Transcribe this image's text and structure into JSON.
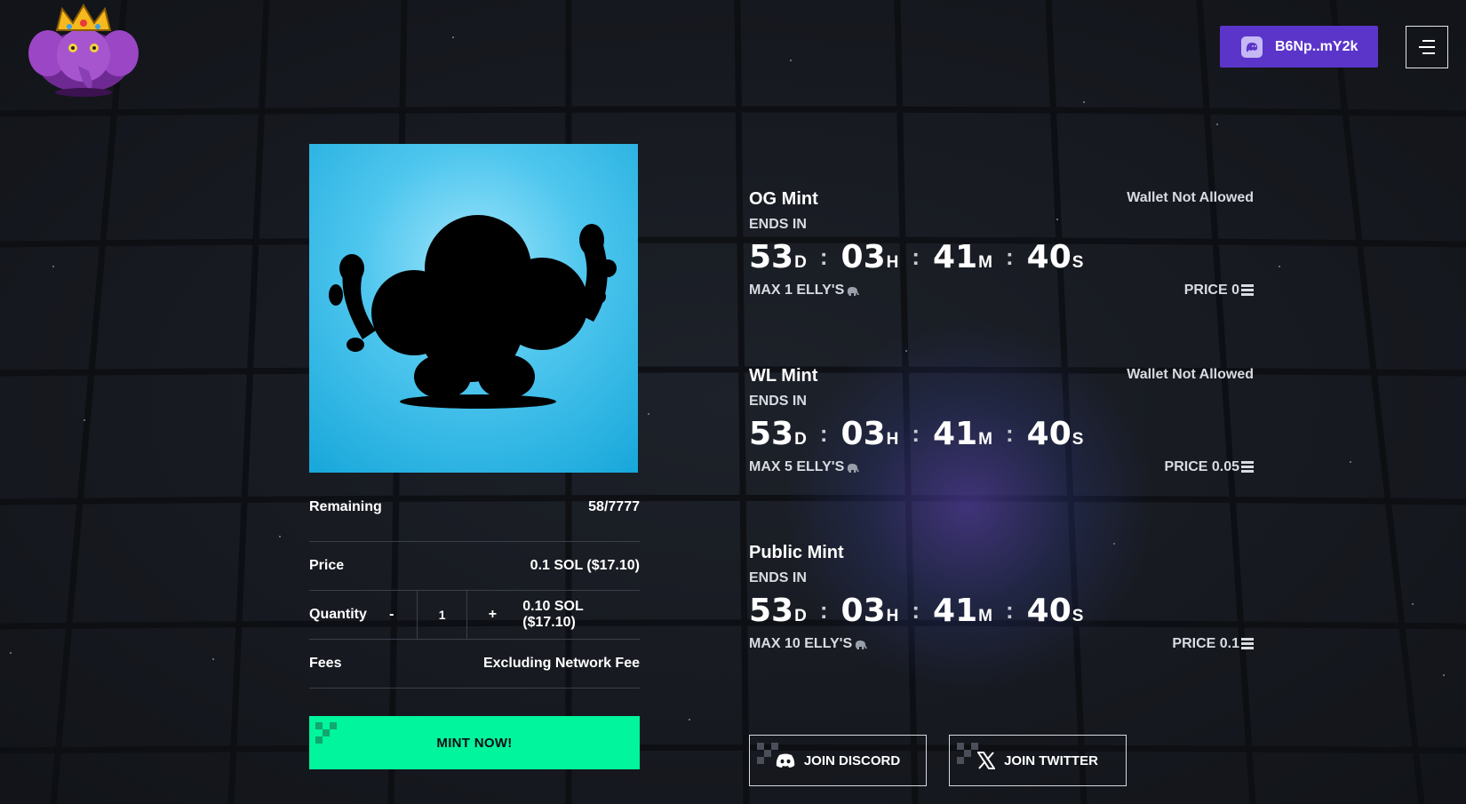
{
  "header": {
    "logo_alt": "Elly crown elephant logo",
    "wallet_label": "B6Np..mY2k",
    "wallet_icon": "ghost-wallet-icon",
    "menu_icon": "hamburger-menu-icon"
  },
  "nft": {
    "image_icon": "elephant-silhouette-icon",
    "image_bg": "#4ec6ee"
  },
  "mint_info": {
    "remaining_label": "Remaining",
    "remaining_value": "58/7777",
    "price_label": "Price",
    "price_value": "0.1 SOL ($17.10)",
    "quantity_label": "Quantity",
    "qty_minus": "-",
    "qty_value": "1",
    "qty_plus": "+",
    "qty_total": "0.10 SOL ($17.10)",
    "fees_label": "Fees",
    "fees_value": "Excluding Network Fee"
  },
  "mint_button": {
    "label": "MINT NOW!",
    "color": "#00f59c"
  },
  "phases": [
    {
      "title": "OG Mint",
      "status": "Wallet Not Allowed",
      "ends_label": "ENDS IN",
      "countdown": {
        "days": "53",
        "hours": "03",
        "minutes": "41",
        "seconds": "40"
      },
      "units": {
        "d": "D",
        "h": "H",
        "m": "M",
        "s": "S"
      },
      "max": "MAX 1 ELLY'S",
      "price": "PRICE 0"
    },
    {
      "title": "WL Mint",
      "status": "Wallet Not Allowed",
      "ends_label": "ENDS IN",
      "countdown": {
        "days": "53",
        "hours": "03",
        "minutes": "41",
        "seconds": "40"
      },
      "units": {
        "d": "D",
        "h": "H",
        "m": "M",
        "s": "S"
      },
      "max": "MAX 5 ELLY'S",
      "price": "PRICE 0.05"
    },
    {
      "title": "Public Mint",
      "status": "",
      "ends_label": "ENDS IN",
      "countdown": {
        "days": "53",
        "hours": "03",
        "minutes": "41",
        "seconds": "40"
      },
      "units": {
        "d": "D",
        "h": "H",
        "m": "M",
        "s": "S"
      },
      "max": "MAX 10 ELLY'S",
      "price": "PRICE 0.1"
    }
  ],
  "social": {
    "discord_label": "JOIN DISCORD",
    "twitter_label": "JOIN TWITTER"
  },
  "colors": {
    "accent": "#5b35c9",
    "mint": "#00f59c",
    "background": "#15181f"
  }
}
